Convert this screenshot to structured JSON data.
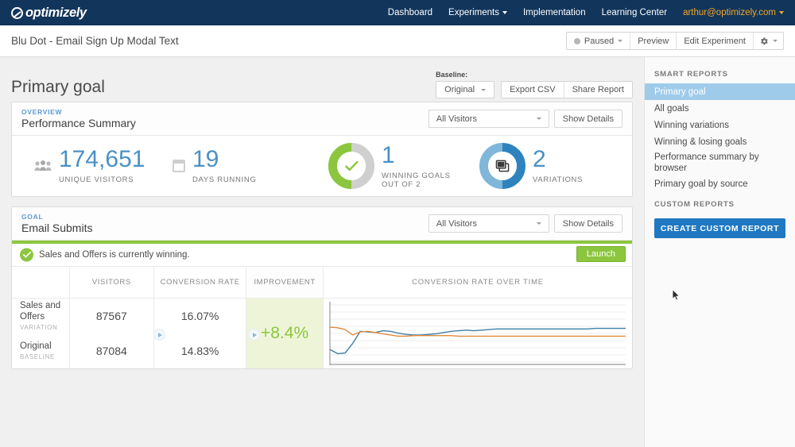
{
  "topnav": {
    "logo_text": "optimizely",
    "links": [
      {
        "label": "Dashboard",
        "caret": false
      },
      {
        "label": "Experiments",
        "caret": true
      },
      {
        "label": "Implementation",
        "caret": false
      },
      {
        "label": "Learning Center",
        "caret": false
      }
    ],
    "user": "arthur@optimizely.com"
  },
  "subheader": {
    "experiment_title": "Blu Dot - Email Sign Up Modal Text",
    "status_label": "Paused",
    "preview_label": "Preview",
    "edit_label": "Edit Experiment"
  },
  "page": {
    "title": "Primary goal",
    "baseline_label": "Baseline:",
    "baseline_value": "Original",
    "export_label": "Export CSV",
    "share_label": "Share Report"
  },
  "overview": {
    "kicker": "OVERVIEW",
    "name": "Performance Summary",
    "filter_value": "All Visitors",
    "show_details": "Show Details",
    "stats": [
      {
        "icon": "people-icon",
        "value": "174,651",
        "label": "UNIQUE VISITORS"
      },
      {
        "icon": "calendar-icon",
        "value": "19",
        "label": "DAYS RUNNING"
      },
      {
        "icon": "check-donut-icon",
        "value": "1",
        "label": "WINNING GOALS",
        "label2": "OUT OF 2"
      },
      {
        "icon": "variations-donut-icon",
        "value": "2",
        "label": "VARIATIONS"
      }
    ]
  },
  "goal": {
    "kicker": "GOAL",
    "name": "Email Submits",
    "filter_value": "All Visitors",
    "show_details": "Show Details",
    "winning_message": "Sales and Offers is currently winning.",
    "launch_label": "Launch",
    "columns": [
      "",
      "VISITORS",
      "CONVERSION RATE",
      "IMPROVEMENT",
      "CONVERSION RATE OVER TIME"
    ],
    "rows": [
      {
        "name": "Sales and Offers",
        "type": "VARIATION",
        "visitors": "87567",
        "conversion_rate": "16.07%"
      },
      {
        "name": "Original",
        "type": "BASELINE",
        "visitors": "87084",
        "conversion_rate": "14.83%"
      }
    ],
    "improvement": "+8.4%"
  },
  "sidebar": {
    "smart_reports_label": "SMART REPORTS",
    "smart_reports": [
      {
        "label": "Primary goal",
        "active": true
      },
      {
        "label": "All goals",
        "active": false
      },
      {
        "label": "Winning variations",
        "active": false
      },
      {
        "label": "Winning & losing goals",
        "active": false
      },
      {
        "label": "Performance summary by browser",
        "active": false,
        "two_line": true
      },
      {
        "label": "Primary goal by source",
        "active": false
      }
    ],
    "custom_reports_label": "CUSTOM REPORTS",
    "create_button": "CREATE CUSTOM REPORT"
  },
  "colors": {
    "nav_bg": "#12355b",
    "accent_blue": "#4a90c4",
    "accent_green": "#8cc63e",
    "button_blue": "#1f78c1",
    "user_orange": "#f5a623",
    "improvement_bg": "#eef4d8",
    "sidebar_active": "#9fcbeb"
  },
  "chart_data": {
    "type": "line",
    "title": "CONVERSION RATE OVER TIME",
    "xlabel": "",
    "ylabel": "",
    "grid": true,
    "legend_position": "none",
    "x": [
      0,
      1,
      2,
      3,
      4,
      5,
      6,
      7,
      8,
      9,
      10,
      11,
      12,
      13,
      14,
      15,
      16,
      17,
      18,
      19,
      20,
      21,
      22,
      23,
      24,
      25,
      26,
      27,
      28,
      29,
      30,
      31,
      32,
      33,
      34,
      35,
      36,
      37,
      38,
      39
    ],
    "ylim": [
      10.5,
      20.0
    ],
    "series": [
      {
        "name": "Sales and Offers",
        "color": "#3f7fa8",
        "values": [
          12.6,
          11.9,
          12.0,
          13.6,
          15.6,
          15.5,
          15.4,
          15.7,
          15.6,
          15.3,
          15.1,
          15.0,
          15.0,
          15.1,
          15.2,
          15.4,
          15.6,
          15.7,
          15.8,
          15.7,
          15.8,
          15.9,
          16.0,
          16.0,
          16.0,
          16.0,
          16.0,
          16.0,
          16.0,
          16.0,
          16.0,
          16.0,
          16.0,
          16.0,
          16.0,
          16.1,
          16.1,
          16.1,
          16.1,
          16.1
        ]
      },
      {
        "name": "Original",
        "color": "#e08a3c",
        "values": [
          16.3,
          16.2,
          15.9,
          15.0,
          15.5,
          15.6,
          15.4,
          15.2,
          15.0,
          14.8,
          14.8,
          14.9,
          14.9,
          14.9,
          14.9,
          14.9,
          14.9,
          14.8,
          14.8,
          14.8,
          14.8,
          14.8,
          14.8,
          14.8,
          14.8,
          14.8,
          14.8,
          14.8,
          14.8,
          14.8,
          14.8,
          14.8,
          14.8,
          14.8,
          14.8,
          14.8,
          14.8,
          14.8,
          14.8,
          14.8
        ]
      }
    ]
  }
}
